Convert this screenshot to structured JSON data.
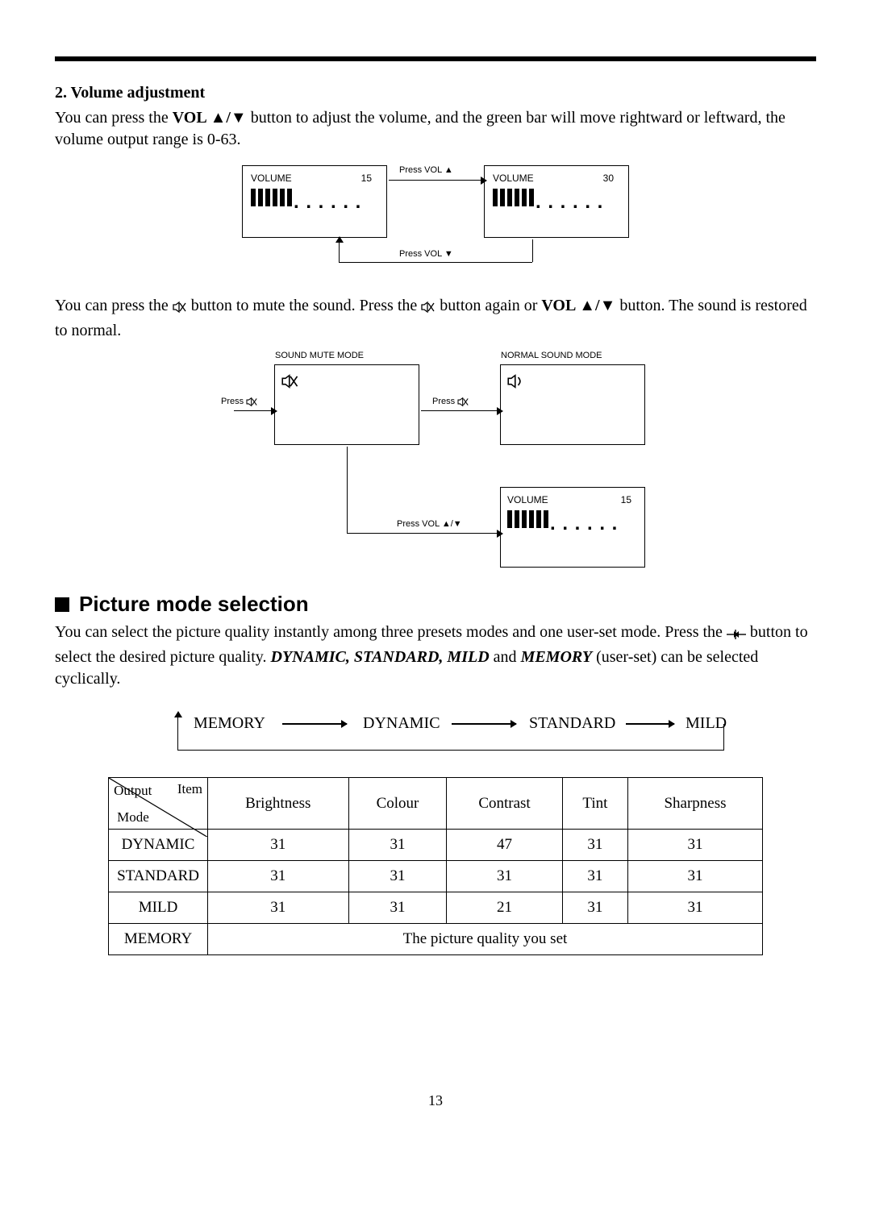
{
  "h1": "2. Volume adjustment",
  "p1a": "You can press the ",
  "p1_vol": "VOL ▲/▼",
  "p1b": " button to adjust the volume, and the green bar will move rightward or leftward, the volume output range is 0-63.",
  "d1": {
    "left": {
      "label": "VOLUME",
      "value": "15"
    },
    "right": {
      "label": "VOLUME",
      "value": "30"
    },
    "press_up": "Press VOL ▲",
    "press_down": "Press VOL ▼"
  },
  "p2a": "You can press the ",
  "p2b": " button to mute the sound. Press the ",
  "p2c": " button again or ",
  "p2_vol": "VOL ▲/▼",
  "p2d": " button. The sound is restored to normal.",
  "d2": {
    "mute_title": "SOUND MUTE MODE",
    "normal_title": "NORMAL SOUND MODE",
    "press": "Press ",
    "press_volud": "Press VOL ▲/▼",
    "bottom": {
      "label": "VOLUME",
      "value": "15"
    }
  },
  "section2": "Picture mode selection",
  "p3a": "You can select the picture quality instantly among three presets modes and one user-set mode. Press the ",
  "p3b": " button to select the desired picture quality. ",
  "p3_modes": "DYNAMIC, STANDARD, MILD",
  "p3c": " and ",
  "p3_mem": "MEMORY",
  "p3d": " (user-set) can be selected cyclically.",
  "cycle": [
    "MEMORY",
    "DYNAMIC",
    "STANDARD",
    "MILD"
  ],
  "table": {
    "corner_output": "Output",
    "corner_item": "Item",
    "corner_mode": "Mode",
    "cols": [
      "Brightness",
      "Colour",
      "Contrast",
      "Tint",
      "Sharpness"
    ],
    "rows": [
      {
        "name": "DYNAMIC",
        "vals": [
          "31",
          "31",
          "47",
          "31",
          "31"
        ]
      },
      {
        "name": "STANDARD",
        "vals": [
          "31",
          "31",
          "31",
          "31",
          "31"
        ]
      },
      {
        "name": "MILD",
        "vals": [
          "31",
          "31",
          "21",
          "31",
          "31"
        ]
      }
    ],
    "memory_row": "MEMORY",
    "memory_text": "The picture quality you set"
  },
  "pagenum": "13"
}
